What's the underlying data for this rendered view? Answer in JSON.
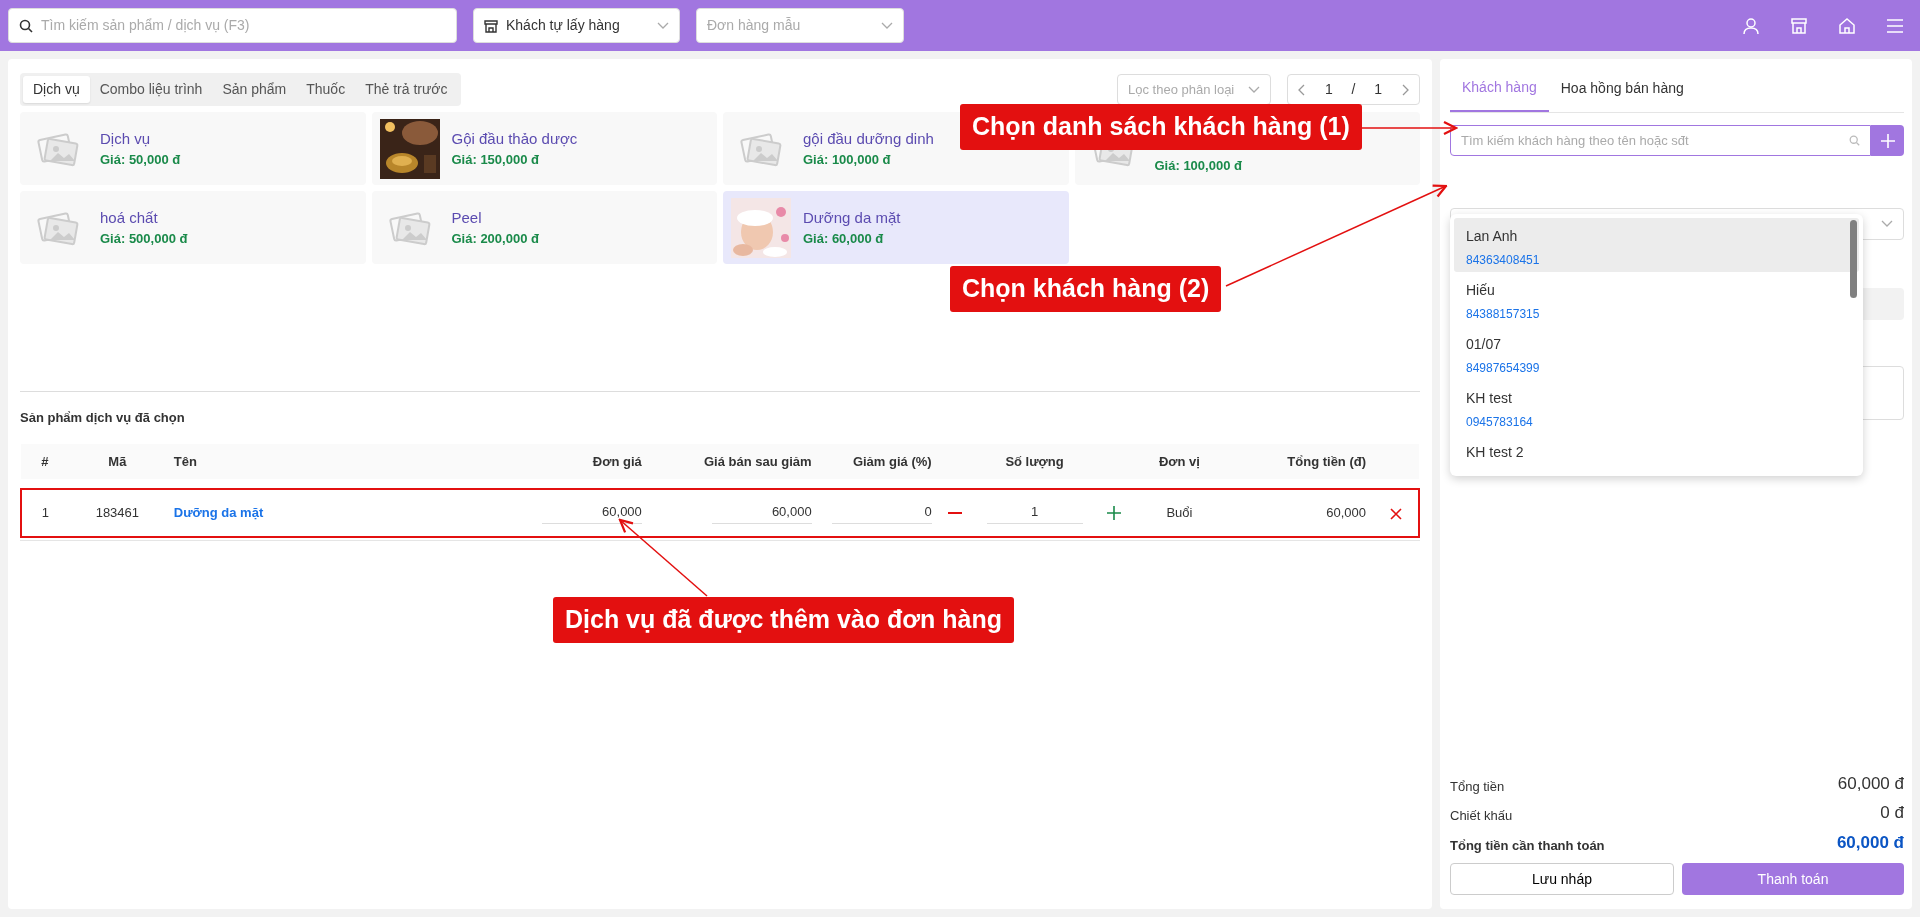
{
  "topbar": {
    "search": {
      "placeholder": "Tìm kiếm sản phẩm / dịch vụ (F3)"
    },
    "delivery": {
      "value": "Khách tự lấy hàng"
    },
    "template": {
      "placeholder": "Đơn hàng mẫu"
    }
  },
  "category_tabs": [
    {
      "label": "Dịch vụ",
      "selected": true
    },
    {
      "label": "Combo liệu trình",
      "selected": false
    },
    {
      "label": "Sản phẩm",
      "selected": false
    },
    {
      "label": "Thuốc",
      "selected": false
    },
    {
      "label": "Thẻ trả trước",
      "selected": false
    }
  ],
  "filter": {
    "placeholder": "Lọc theo phân loại"
  },
  "pagination": {
    "page": "1",
    "separator": "/",
    "total": "1"
  },
  "products": [
    {
      "name": "Dịch vụ",
      "price": "Giá: 50,000 đ",
      "kind": "placeholder",
      "selected": false
    },
    {
      "name": "Gội đầu thảo dược",
      "price": "Giá: 150,000 đ",
      "kind": "picture",
      "selected": false
    },
    {
      "name": "gội đầu dưỡng dinh",
      "price": "Giá: 100,000 đ",
      "kind": "placeholder",
      "selected": false
    },
    {
      "price": "Giá: 100,000 đ",
      "kind": "placeholder",
      "selected": false
    },
    {
      "name": "hoá chất",
      "price": "Giá: 500,000 đ",
      "kind": "placeholder",
      "selected": false
    },
    {
      "name": "Peel",
      "price": "Giá: 200,000 đ",
      "kind": "placeholder",
      "selected": false
    },
    {
      "name": "Dưỡng da mặt",
      "price": "Giá: 60,000 đ",
      "kind": "picture",
      "selected": true
    }
  ],
  "selected_section": {
    "title": "Sản phẩm dịch vụ đã chọn",
    "columns": [
      "#",
      "Mã",
      "Tên",
      "Đơn giá",
      "Giá bán sau giảm",
      "Giảm giá (%)",
      "Số lượng",
      "Đơn vị",
      "Tổng tiền (đ)"
    ],
    "rows": [
      {
        "index": "1",
        "code": "183461",
        "name": "Dưỡng da mặt",
        "unit_price": "60,000",
        "sale_price": "60,000",
        "discount": "0",
        "quantity": "1",
        "unit": "Buổi",
        "total": "60,000"
      }
    ]
  },
  "side_tabs": [
    {
      "label": "Khách hàng",
      "selected": true
    },
    {
      "label": "Hoa hồng bán hàng",
      "selected": false
    }
  ],
  "customer_search": {
    "placeholder": "Tìm kiếm khách hàng theo tên hoặc sđt"
  },
  "customers": [
    {
      "name": "Lan Anh",
      "phone": "84363408451",
      "selected": true
    },
    {
      "name": "Hiếu",
      "phone": "84388157315",
      "selected": false
    },
    {
      "name": "01/07",
      "phone": "84987654399",
      "selected": false
    },
    {
      "name": "KH test",
      "phone": "0945783164",
      "selected": false
    },
    {
      "name": "KH test 2",
      "selected": false
    }
  ],
  "summary": [
    {
      "label": "Tổng tiền",
      "value": "60,000 đ",
      "kind": "normal"
    },
    {
      "label": "Chiết khấu",
      "value": "0 đ",
      "kind": "normal"
    },
    {
      "label": "Tổng tiền cần thanh toán",
      "value": "60,000 đ",
      "kind": "total"
    }
  ],
  "actions": {
    "draft": "Lưu nháp",
    "pay": "Thanh toán"
  },
  "annotations": [
    {
      "text": "Chọn danh sách khách hàng (1)"
    },
    {
      "text": "Chọn khách hàng (2)"
    },
    {
      "text": "Dịch vụ đã được thêm vào đơn hàng"
    }
  ]
}
